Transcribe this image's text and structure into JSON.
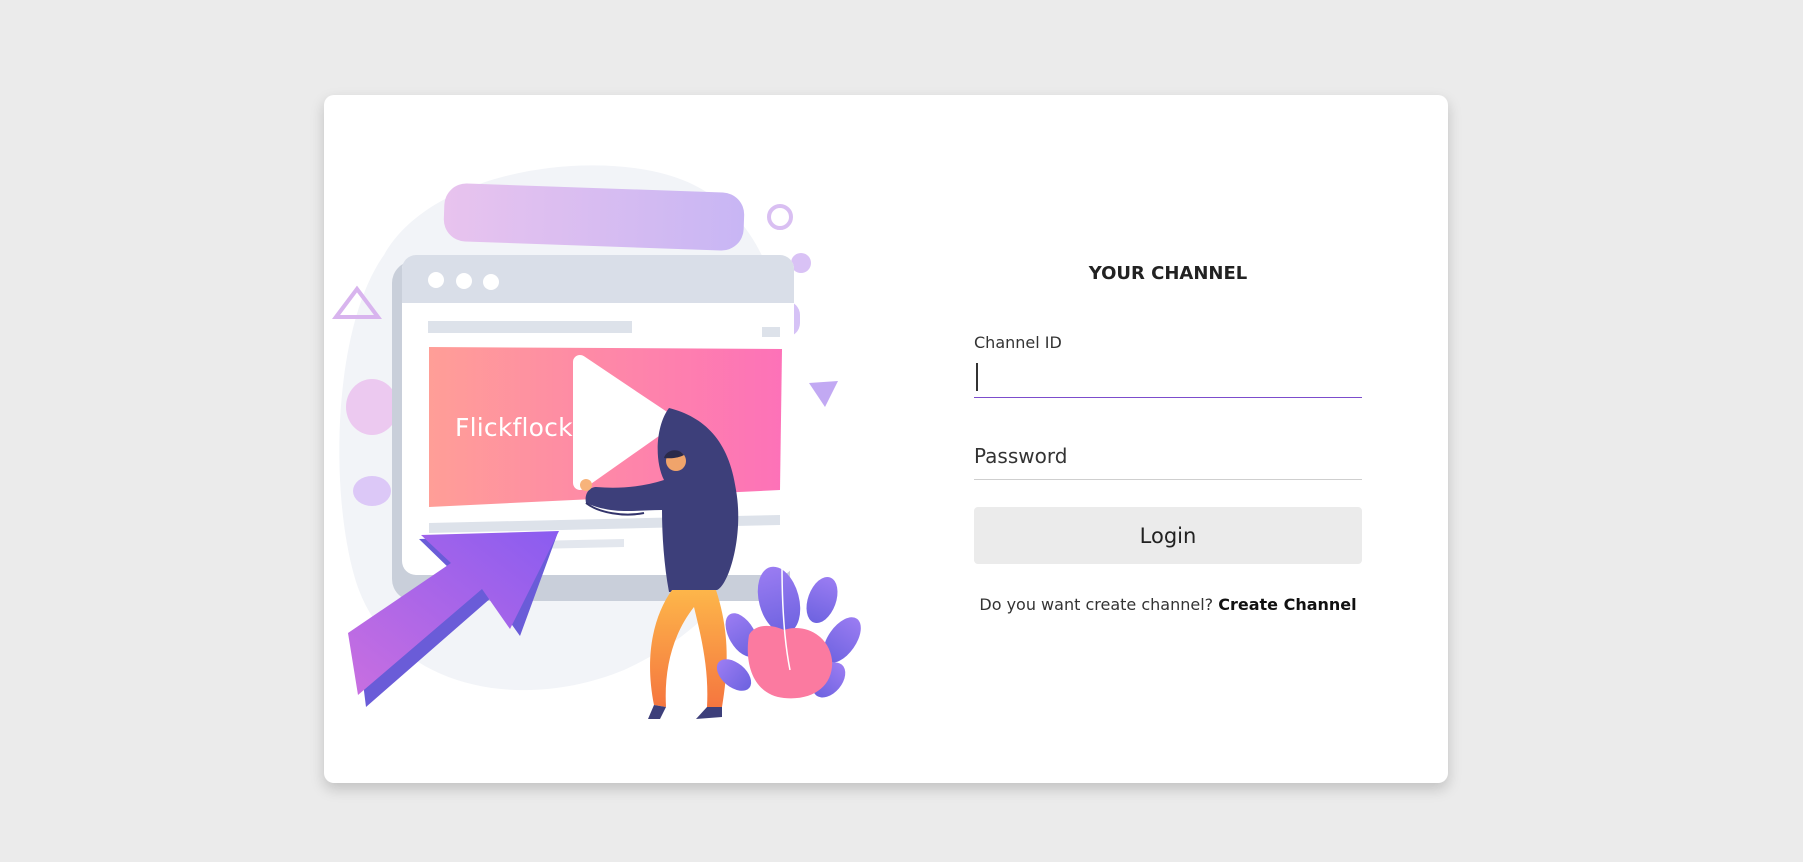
{
  "illustration": {
    "brand_text": "Flickflock"
  },
  "form": {
    "title": "YOUR CHANNEL",
    "channel_id_label": "Channel ID",
    "channel_id_value": "",
    "password_placeholder": "Password",
    "login_label": "Login",
    "signup_prompt": "Do you want create channel?",
    "signup_link": "Create Channel"
  },
  "colors": {
    "background": "#ebebeb",
    "card": "#ffffff",
    "accent_underline": "#7c4dcc",
    "button": "#ebebeb"
  }
}
